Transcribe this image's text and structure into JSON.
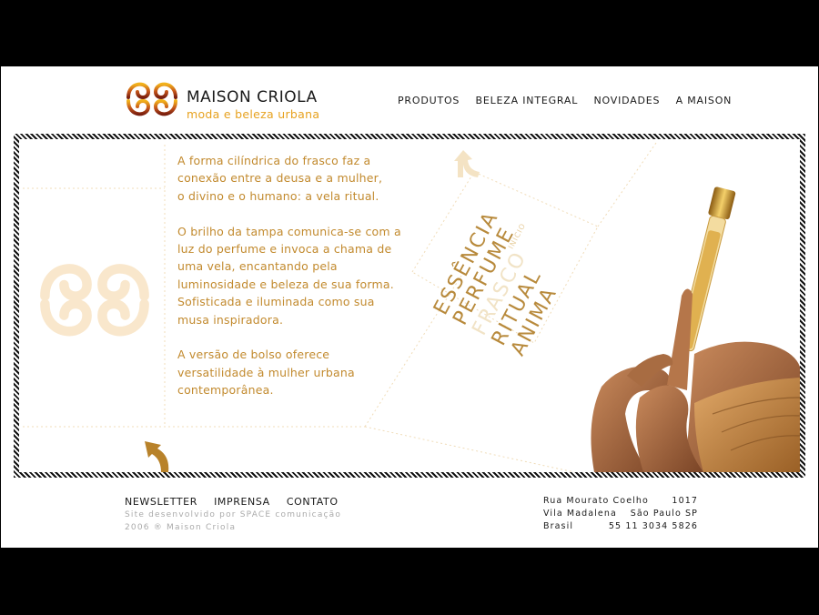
{
  "brand": {
    "name": "MAISON CRIOLA",
    "tagline": "moda e beleza urbana",
    "colors": {
      "gold": "#e7a21f",
      "brown": "#8b2a10",
      "text_gold": "#c28a2e"
    }
  },
  "nav": {
    "items": [
      "PRODUTOS",
      "BELEZA INTEGRAL",
      "NOVIDADES",
      "A MAISON"
    ]
  },
  "content": {
    "paragraphs": [
      "A forma cilíndrica do frasco faz a conexão entre a deusa e a mulher, o divino e o humano: a vela ritual.",
      "O brilho da tampa comunica-se com a luz do perfume e invoca a chama de uma vela, encantando pela luminosidade e beleza de sua forma. Sofisticada e iluminada como sua musa inspiradora.",
      "A versão de bolso oferece versatilidade à mulher urbana contemporânea."
    ],
    "paragraph_lines": [
      [
        "A forma cilíndrica do frasco faz a",
        "conexão entre a deusa e a mulher,",
        "o divino e o humano: a vela ritual."
      ],
      [
        "O brilho da tampa comunica-se com a",
        "luz do perfume e invoca a chama de",
        "uma vela, encantando pela",
        "luminosidade e beleza de sua forma.",
        "Sofisticada e iluminada como sua",
        "musa inspiradora."
      ],
      [
        "A versão de bolso oferece",
        "versatilidade à mulher urbana",
        "contemporânea."
      ]
    ],
    "slogan": [
      "ESSÊNCIA",
      "PERFUME",
      "FRASCO",
      "RITUAL",
      "ANIMA"
    ],
    "inicio_label": "INICIO",
    "back_arrow_icon": "back-arrow-icon"
  },
  "footer": {
    "links": [
      "NEWSLETTER",
      "IMPRENSA",
      "CONTATO"
    ],
    "credit_line1": "Site desenvolvido por SPACE comunicação",
    "credit_line2": "2006 ® Maison Criola",
    "address": {
      "street": "Rua Mourato Coelho",
      "number": "1017",
      "district": "Vila Madalena",
      "city": "São Paulo SP",
      "country": "Brasil",
      "phone": "55 11 3034 5826"
    }
  }
}
